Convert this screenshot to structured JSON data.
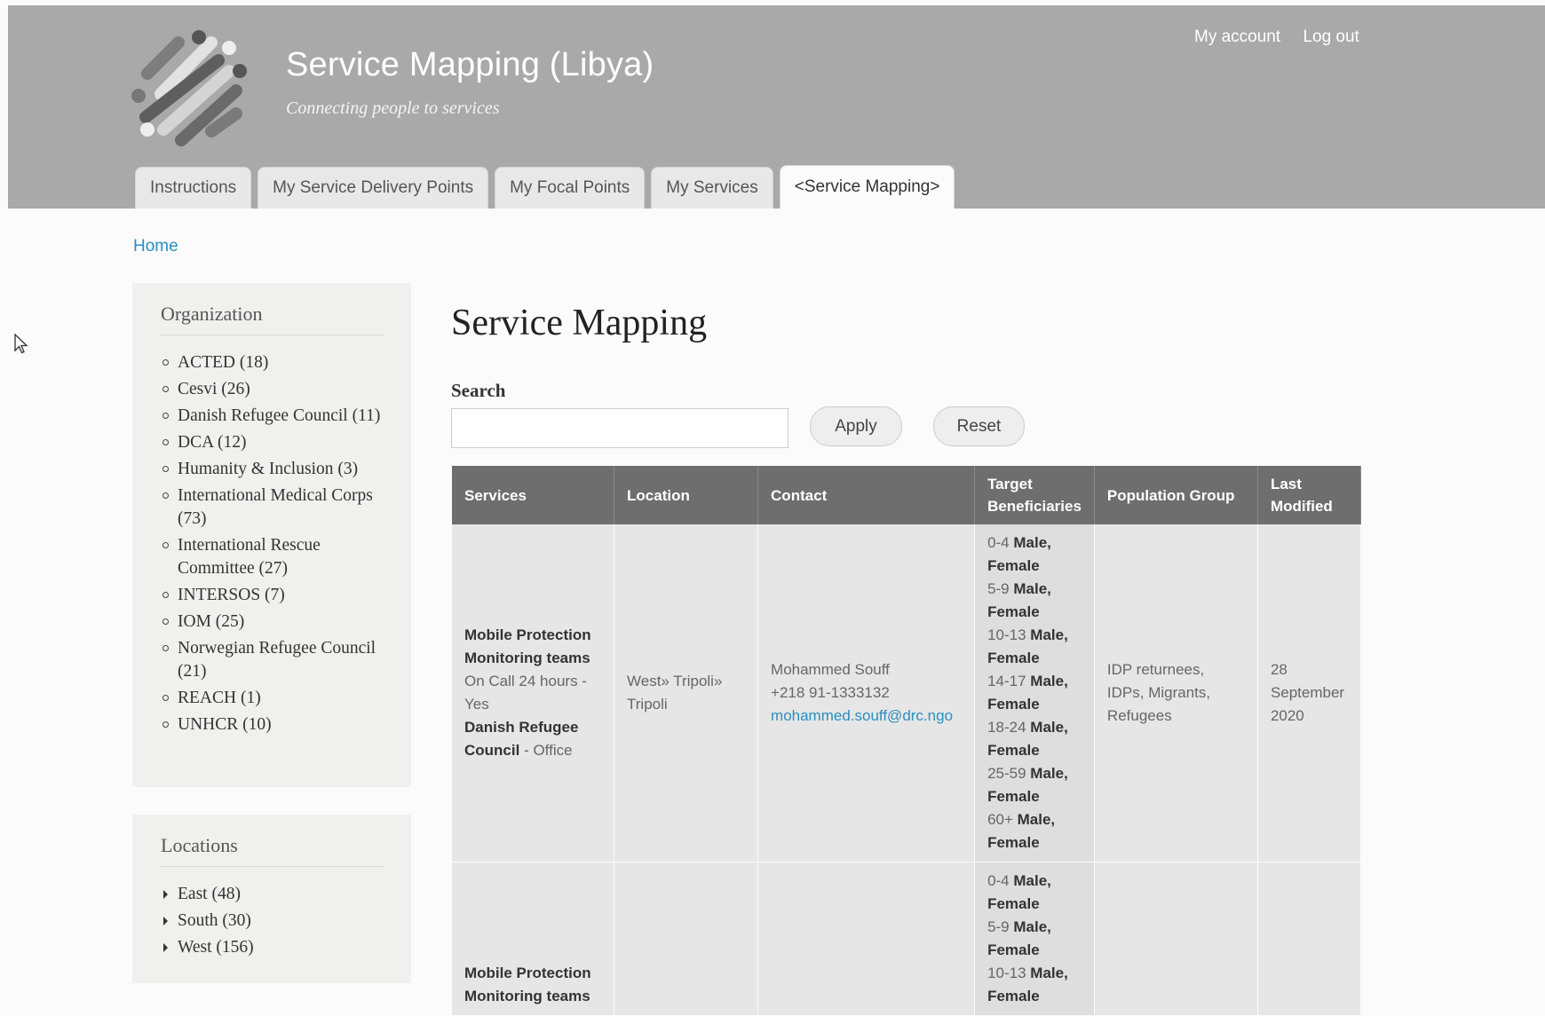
{
  "site": {
    "name": "Service Mapping (Libya)",
    "slogan": "Connecting people to services"
  },
  "secondary_menu": [
    "My account",
    "Log out"
  ],
  "tabs": [
    {
      "label": "Instructions",
      "active": false
    },
    {
      "label": "My Service Delivery Points",
      "active": false
    },
    {
      "label": "My Focal Points",
      "active": false
    },
    {
      "label": "My Services",
      "active": false
    },
    {
      "label": "<Service Mapping>",
      "active": true
    }
  ],
  "breadcrumb": {
    "home": "Home"
  },
  "sidebar": {
    "organization": {
      "title": "Organization",
      "items": [
        {
          "label": "ACTED (18)"
        },
        {
          "label": "Cesvi (26)"
        },
        {
          "label": "Danish Refugee Council (11)"
        },
        {
          "label": "DCA (12)"
        },
        {
          "label": "Humanity & Inclusion (3)"
        },
        {
          "label": "International Medical Corps (73)"
        },
        {
          "label": "International Rescue Committee (27)"
        },
        {
          "label": "INTERSOS (7)"
        },
        {
          "label": "IOM (25)"
        },
        {
          "label": "Norwegian Refugee Council (21)"
        },
        {
          "label": "REACH (1)"
        },
        {
          "label": "UNHCR (10)"
        }
      ]
    },
    "locations": {
      "title": "Locations",
      "items": [
        {
          "label": "East (48)"
        },
        {
          "label": "South (30)"
        },
        {
          "label": "West (156)"
        }
      ]
    }
  },
  "main": {
    "title": "Service Mapping",
    "search": {
      "label": "Search",
      "value": "",
      "placeholder": ""
    },
    "apply_label": "Apply",
    "reset_label": "Reset",
    "table": {
      "headers": {
        "services": "Services",
        "location": "Location",
        "contact": "Contact",
        "target": "Target Beneficiaries",
        "population": "Population Group",
        "modified": "Last Modified"
      },
      "rows": [
        {
          "service_name": "Mobile Protection Monitoring teams",
          "service_detail": "On Call 24 hours - Yes",
          "org_name": "Danish Refugee Council",
          "org_detail": " - Office",
          "location": "West» Tripoli» Tripoli",
          "contact_name": "Mohammed Souff",
          "contact_phone": "+218 91-1333132",
          "contact_email": "mohammed.souff@drc.ngo",
          "target_groups": [
            {
              "age": "0-4",
              "gender": "Male, Female"
            },
            {
              "age": "5-9",
              "gender": "Male, Female"
            },
            {
              "age": "10-13",
              "gender": "Male, Female"
            },
            {
              "age": "14-17",
              "gender": "Male, Female"
            },
            {
              "age": "18-24",
              "gender": "Male, Female"
            },
            {
              "age": "25-59",
              "gender": "Male, Female"
            },
            {
              "age": "60+",
              "gender": "Male, Female"
            }
          ],
          "population": "IDP returnees, IDPs, Migrants, Refugees",
          "modified": "28 September 2020"
        },
        {
          "service_name": "Mobile Protection Monitoring teams",
          "service_detail": "",
          "org_name": "",
          "org_detail": "",
          "location": "",
          "contact_name": "",
          "contact_phone": "",
          "contact_email": "",
          "target_groups": [
            {
              "age": "0-4",
              "gender": "Male, Female"
            },
            {
              "age": "5-9",
              "gender": "Male, Female"
            },
            {
              "age": "10-13",
              "gender": "Male, Female"
            }
          ],
          "population": "",
          "modified": ""
        }
      ]
    }
  },
  "colors": {
    "header_bg": "#a9a9a9",
    "link": "#2a8fc0",
    "table_header": "#6e6e6e",
    "table_cell": "#e6e6e6",
    "sidebar_bg": "#f0f0ee"
  },
  "icons": [
    "site-logo-icon",
    "mouse-cursor-icon"
  ]
}
